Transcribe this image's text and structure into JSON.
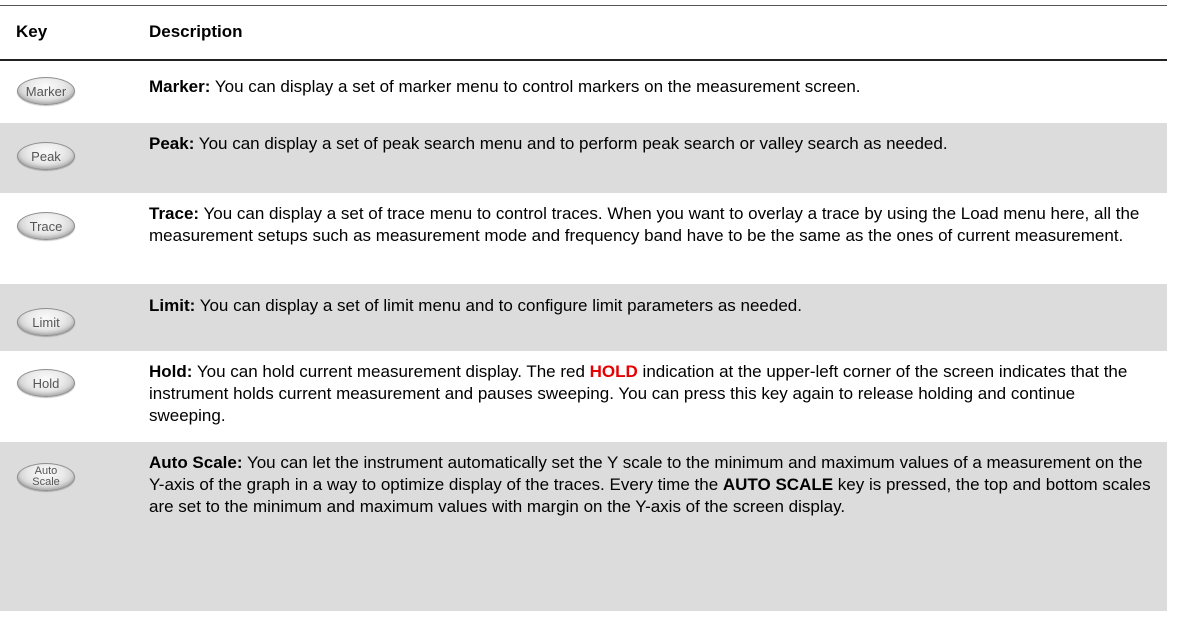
{
  "header": {
    "key": "Key",
    "description": "Description"
  },
  "rows": [
    {
      "key_label": "Marker",
      "title": "Marker:",
      "text": " You can display a set of marker menu to control markers on the measurement screen."
    },
    {
      "key_label": "Peak",
      "title": "Peak:",
      "text": " You can display a set of peak search menu and to perform peak search or valley search as needed."
    },
    {
      "key_label": "Trace",
      "title": "Trace:",
      "text": " You can display a set of trace menu to control traces. When you want to overlay a trace by using the Load menu here, all the measurement setups such as measurement mode and frequency band have to be the same as the ones of current measurement."
    },
    {
      "key_label": "Limit",
      "title": "Limit:",
      "text": " You can display a set of limit menu and to configure limit parameters as needed."
    },
    {
      "key_label": "Hold",
      "title": "Hold:",
      "text_a": " You can hold current measurement display. The red ",
      "highlight": "HOLD",
      "text_b": " indication at the upper-left corner of the screen indicates that the instrument holds current measurement and pauses sweeping. You can press this key again to release holding and continue sweeping."
    },
    {
      "key_label_line1": "Auto",
      "key_label_line2": "Scale",
      "title": "Auto Scale:",
      "text_a": " You can let the instrument automatically set the Y scale to the minimum and maximum values of a measurement on the Y-axis of the graph in a way to optimize display of the traces. Every time the ",
      "bold_inline": "AUTO SCALE",
      "text_b": " key is pressed, the top and bottom scales are set to the minimum and maximum values with margin on the Y-axis of the screen display."
    }
  ],
  "colors": {
    "shade": "#dcdcdc",
    "highlight_red": "#e60000"
  }
}
